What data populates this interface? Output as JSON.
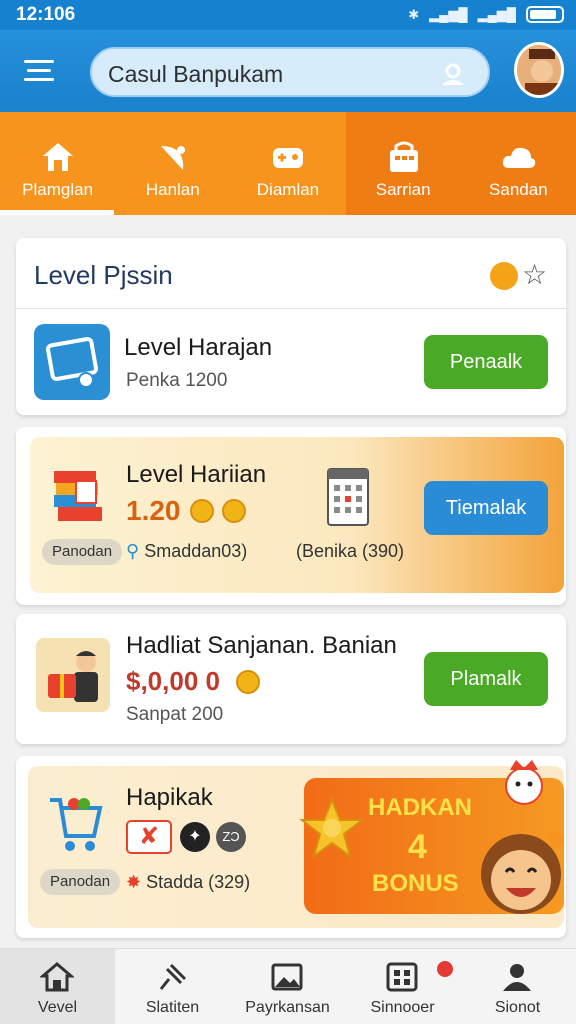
{
  "status_bar": {
    "time": "12:106"
  },
  "header": {
    "search_text": "Casul Banpukam",
    "icons": [
      "menu-icon",
      "user-icon",
      "avatar"
    ]
  },
  "top_tabs": [
    {
      "label": "Plamglan",
      "icon": "home-icon",
      "active": true
    },
    {
      "label": "Hanlan",
      "icon": "satellite-icon"
    },
    {
      "label": "Diamlan",
      "icon": "gamepad-icon"
    },
    {
      "label": "Sarrian",
      "icon": "shop-icon"
    },
    {
      "label": "Sandan",
      "icon": "cloud-icon"
    }
  ],
  "section": {
    "title": "Level Pjssin",
    "row": {
      "title": "Level Harajan",
      "subtitle": "Penka 1200",
      "button": "Penaalk"
    }
  },
  "card2": {
    "title": "Level Hariian",
    "value": "1.20",
    "pill": "Panodan",
    "meta1": "Smaddan03)",
    "meta2": "(Benika (390)",
    "button": "Tiemalak"
  },
  "card3": {
    "title": "Hadliat Sanjanan. Banian",
    "amount": "$,0,00 0",
    "subtitle": "Sanpat 200",
    "button": "Plamalk"
  },
  "card4": {
    "title": "Hapikak",
    "pill": "Panodan",
    "meta": "Stadda (329)",
    "badge_text": "ZƆ",
    "bonus": {
      "line1": "HADKAN",
      "line2": "4",
      "line3": "BONUS"
    }
  },
  "bottom_nav": [
    {
      "label": "Vevel",
      "icon": "home-icon",
      "active": true
    },
    {
      "label": "Slatiten",
      "icon": "pin-icon"
    },
    {
      "label": "Payrkansan",
      "icon": "image-icon"
    },
    {
      "label": "Sinnooer",
      "icon": "grid-icon"
    },
    {
      "label": "Sionot",
      "icon": "person-icon"
    }
  ],
  "colors": {
    "primary": "#1b82cc",
    "accent": "#f7941d",
    "green": "#4aaa25",
    "blue": "#2a8bd6"
  }
}
